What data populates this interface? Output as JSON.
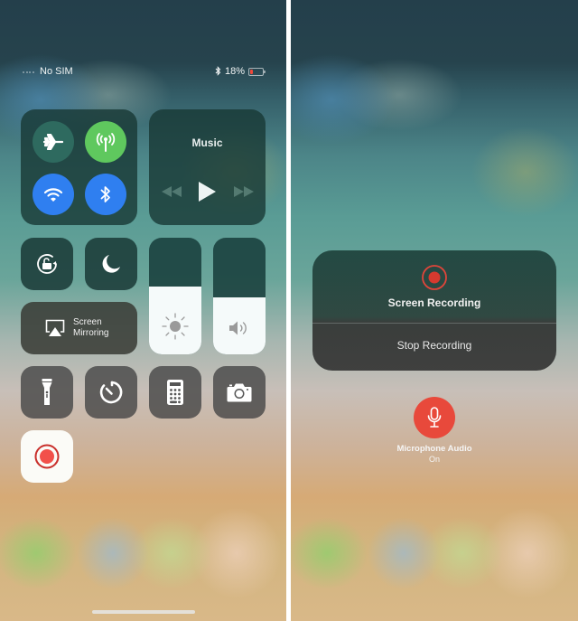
{
  "status_bar": {
    "carrier": "No SIM",
    "bluetooth_icon": "bluetooth-icon",
    "battery_percent": "18%",
    "battery_level": 0.18,
    "battery_color": "#f0483a"
  },
  "control_center": {
    "connectivity": [
      {
        "name": "airplane-mode",
        "icon": "airplane-icon",
        "active": false
      },
      {
        "name": "cellular-data",
        "icon": "antenna-icon",
        "active": true,
        "color": "#5fc85e"
      },
      {
        "name": "wifi",
        "icon": "wifi-icon",
        "active": true,
        "color": "#2f7ff0"
      },
      {
        "name": "bluetooth",
        "icon": "bluetooth-icon",
        "active": true,
        "color": "#2f7ff0"
      }
    ],
    "music": {
      "title": "Music",
      "controls": [
        "rewind-icon",
        "play-icon",
        "fast-forward-icon"
      ]
    },
    "rotation_lock": {
      "icon": "rotation-lock-icon"
    },
    "do_not_disturb": {
      "icon": "moon-icon"
    },
    "screen_mirroring": {
      "icon": "airplay-icon",
      "label_line1": "Screen",
      "label_line2": "Mirroring"
    },
    "brightness": {
      "icon": "sun-icon",
      "level": 0.58
    },
    "volume": {
      "icon": "speaker-icon",
      "level": 0.49
    },
    "shortcuts": [
      {
        "name": "flashlight",
        "icon": "flashlight-icon"
      },
      {
        "name": "timer",
        "icon": "timer-icon"
      },
      {
        "name": "calculator",
        "icon": "calculator-icon"
      },
      {
        "name": "camera",
        "icon": "camera-icon"
      }
    ],
    "screen_recording": {
      "icon": "record-icon",
      "accent": "#e8493b"
    }
  },
  "recording_popup": {
    "title": "Screen Recording",
    "stop_label": "Stop Recording",
    "accent": "#d63a2f"
  },
  "microphone": {
    "label": "Microphone Audio",
    "state": "On",
    "color": "#e8493b"
  }
}
